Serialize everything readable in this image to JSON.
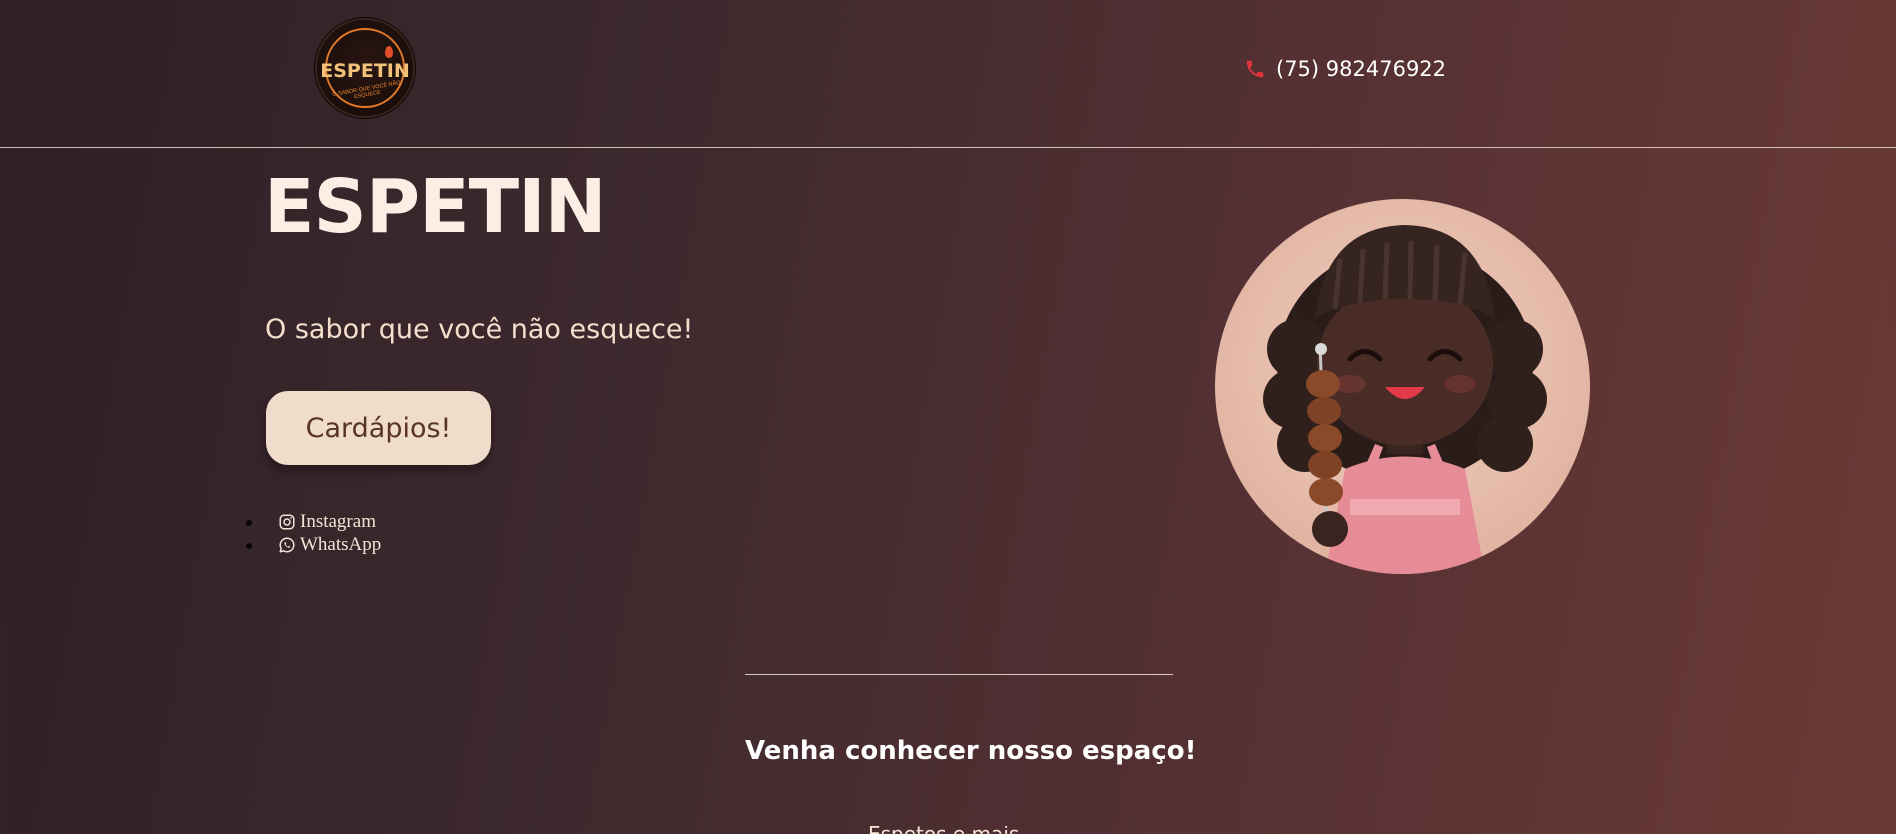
{
  "header": {
    "logo": {
      "word": "ESPETIN",
      "tagline": "O SABOR QUE VOCÊ NÃO ESQUECE",
      "icon": "espetin-logo"
    },
    "phone": {
      "icon": "phone-icon",
      "number": "(75) 982476922"
    }
  },
  "hero": {
    "title": "ESPETIN",
    "tagline": "O sabor que você não esquece!",
    "cta_label": "Cardápios!",
    "avatar_icon": "mascot-girl-with-skewer"
  },
  "social": {
    "items": [
      {
        "icon": "instagram-icon",
        "label": "Instagram"
      },
      {
        "icon": "whatsapp-icon",
        "label": "WhatsApp"
      }
    ]
  },
  "section": {
    "title": "Venha conhecer nosso espaço!",
    "peek_text": "Espetos e mais"
  },
  "colors": {
    "bg_start": "#2e2025",
    "bg_end": "#6a3a35",
    "cta_bg": "#f0dccb",
    "cta_text": "#5a3328",
    "accent_orange": "#e07a2a",
    "phone_red": "#e0353a"
  }
}
